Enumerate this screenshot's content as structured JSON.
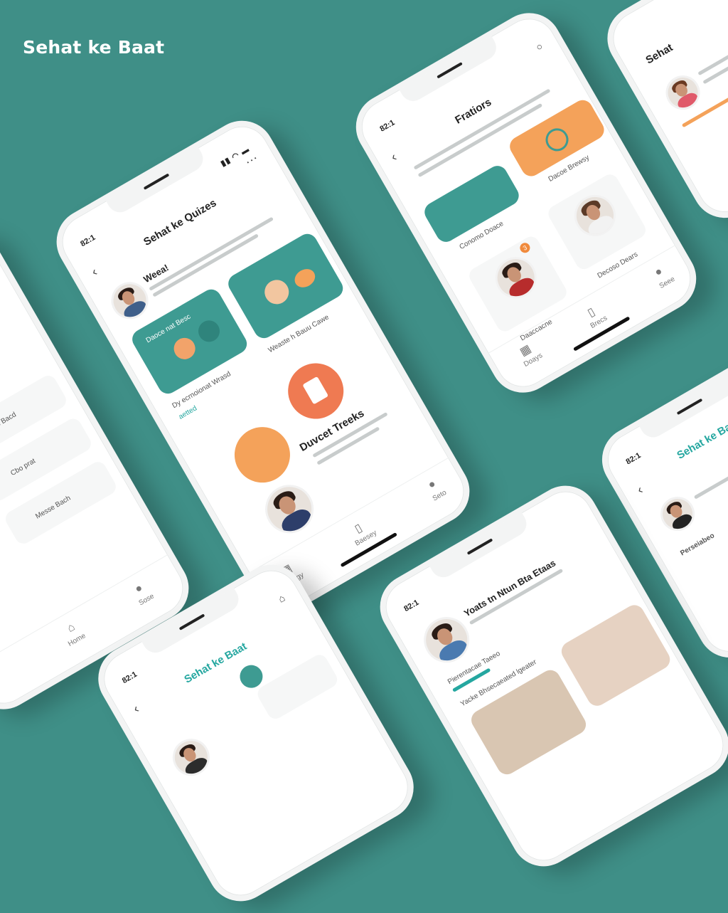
{
  "brand": "Sehat ke Baat",
  "phones": {
    "quiz": {
      "time": "82:1",
      "signal": "▮▮ ◠ ▬",
      "title": "Sehat ke Quizes",
      "menu": "···",
      "greeting": "Weea!",
      "card_left_label": "Daoce nat Besc",
      "card_right_label": "Weaste h Bauu Cawe",
      "caption_left": "Dy ecrnoionat Wrasd",
      "link": "aetted",
      "section_title": "Duvcet Treeks",
      "nav_left": "Doagy",
      "nav_mid": "Baesey",
      "nav_right": "Seto"
    },
    "profiles": {
      "time": "82:1",
      "title": "Fratiors",
      "caption_left": "Conomo Doace",
      "caption_right": "Dacoe Brewsy",
      "badge": "3",
      "person_caption_left": "Daaccacne",
      "person_caption_right": "Decoso Dears",
      "nav_left": "Doays",
      "nav_mid": "Brecs",
      "nav_right": "Seee"
    },
    "left": {
      "items": [
        "Yeas Bacd",
        "Cbo prat",
        "Messe Bach"
      ],
      "nav_mid": "Home",
      "nav_right": "Sose"
    },
    "bottom_left": {
      "time": "82:1",
      "title": "Sehat ke Baat"
    },
    "bottom_right": {
      "time": "82:1",
      "title": "Yoats tn Ntun Bta Etaas",
      "section": "Pierentacae Taeeo",
      "sub": "Yacke Bhsecaeated lgeater"
    },
    "right_edge": {
      "time": "82:1",
      "title": "Sehat ke Baat",
      "section": "Perseiabeo"
    },
    "top_right": {
      "title": "Sehat"
    }
  },
  "colors": {
    "background": "#3f8f87",
    "teal": "#3e9b92",
    "orange": "#f4a25a",
    "accent": "#25a7a0"
  }
}
